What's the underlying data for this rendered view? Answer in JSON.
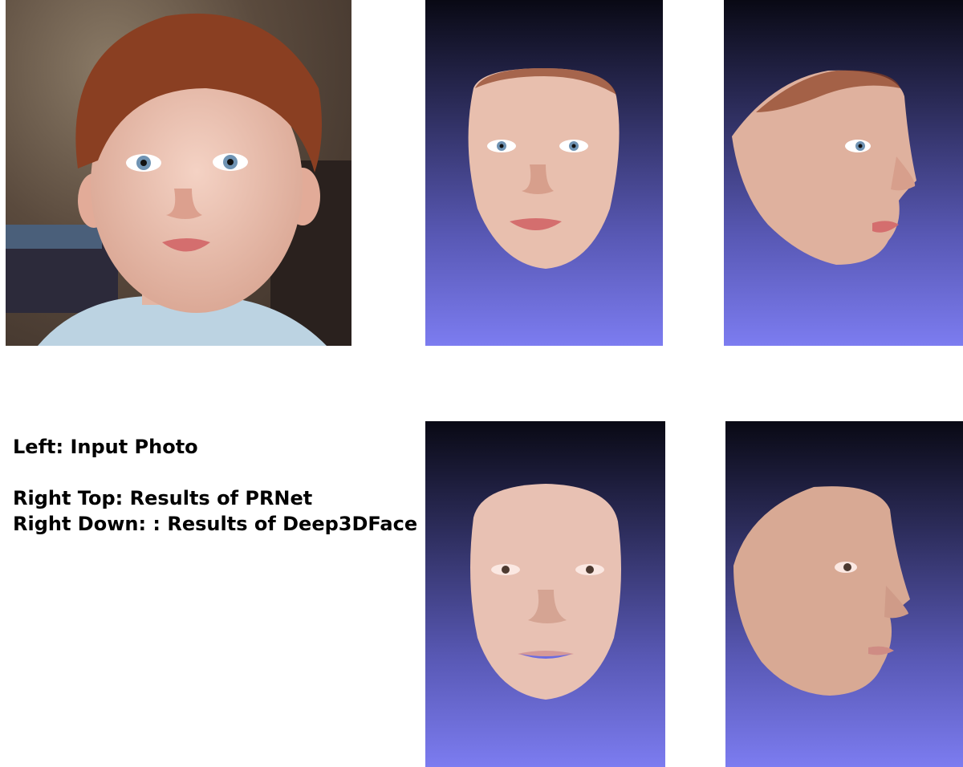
{
  "caption": {
    "line1": "Left: Input Photo",
    "line2": "Right Top: Results of PRNet",
    "line3": "Right Down: : Results of Deep3DFace"
  },
  "panels": {
    "input_photo": "photo-of-child",
    "prnet_front": "face-render-front",
    "prnet_side": "face-render-side",
    "deep3d_front": "face-render-front",
    "deep3d_side": "face-render-side"
  },
  "colors": {
    "render_bg_top": "#090914",
    "render_bg_bottom": "#7c7cf0",
    "skin": "#e8bfae",
    "hair": "#8a3f22",
    "eye": "#6f93b3"
  }
}
